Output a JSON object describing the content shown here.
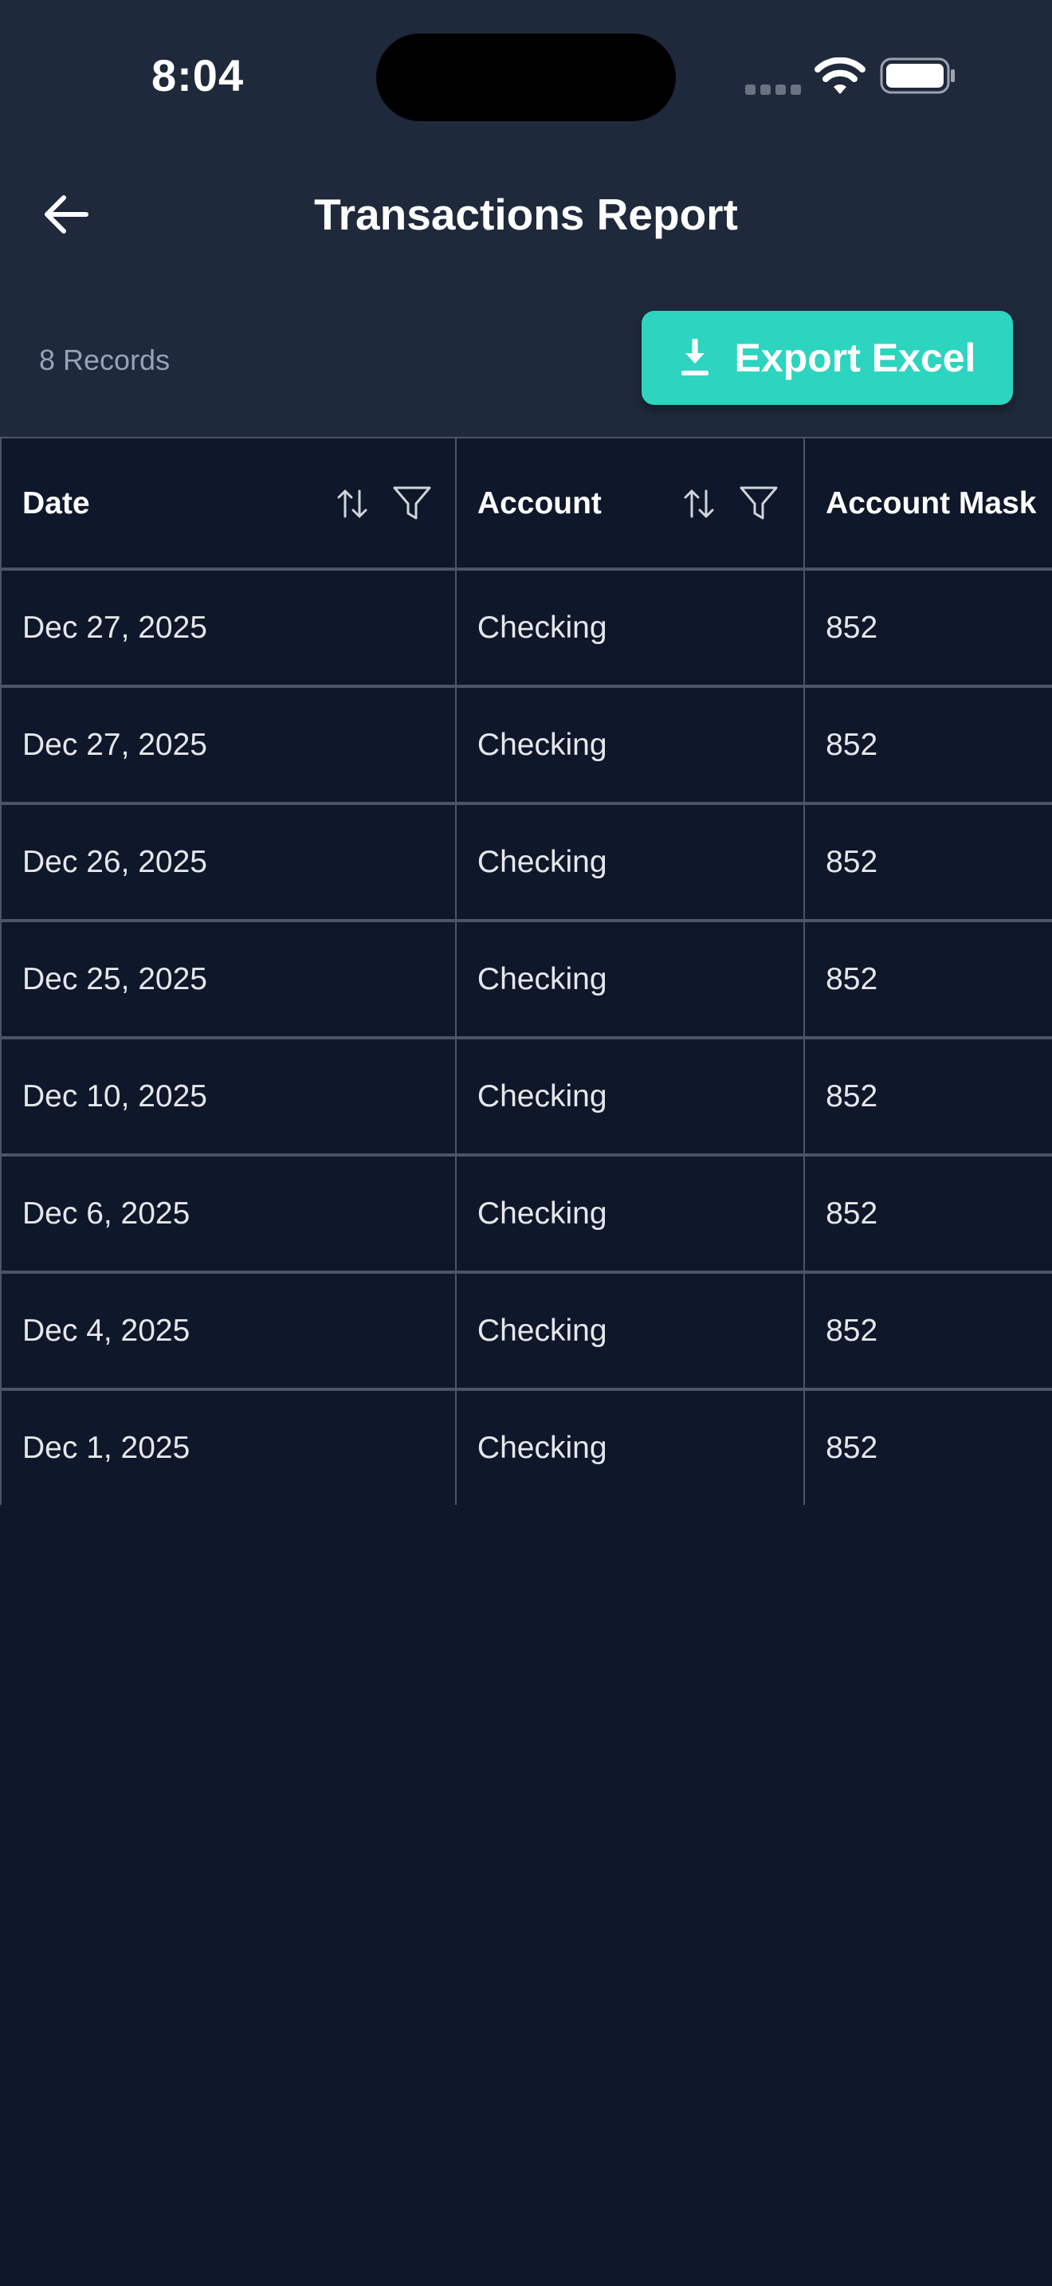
{
  "status_bar": {
    "time": "8:04"
  },
  "header": {
    "title": "Transactions Report",
    "back_icon": "arrow-left-icon"
  },
  "toolbar": {
    "records_label": "8 Records",
    "export_label": "Export Excel",
    "export_icon": "download-icon",
    "accent_color": "#2dd4bf"
  },
  "table": {
    "columns": [
      {
        "label": "Date"
      },
      {
        "label": "Account"
      },
      {
        "label": "Account Mask"
      }
    ],
    "rows": [
      {
        "date": "Dec 27, 2025",
        "account": "Checking",
        "mask": "852"
      },
      {
        "date": "Dec 27, 2025",
        "account": "Checking",
        "mask": "852"
      },
      {
        "date": "Dec 26, 2025",
        "account": "Checking",
        "mask": "852"
      },
      {
        "date": "Dec 25, 2025",
        "account": "Checking",
        "mask": "852"
      },
      {
        "date": "Dec 10, 2025",
        "account": "Checking",
        "mask": "852"
      },
      {
        "date": "Dec 6, 2025",
        "account": "Checking",
        "mask": "852"
      },
      {
        "date": "Dec 4, 2025",
        "account": "Checking",
        "mask": "852"
      },
      {
        "date": "Dec 1, 2025",
        "account": "Checking",
        "mask": "852"
      }
    ]
  }
}
